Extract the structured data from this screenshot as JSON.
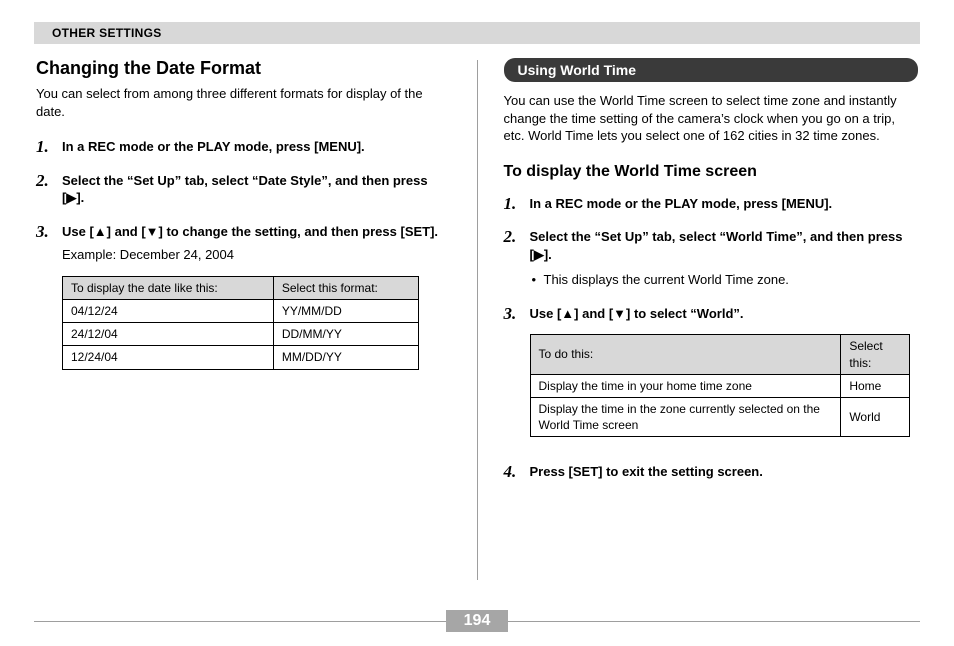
{
  "header": {
    "title": "OTHER SETTINGS"
  },
  "left": {
    "heading": "Changing the Date Format",
    "intro": "You can select from among three different formats for display of the date.",
    "steps": [
      {
        "text": "In a REC mode or the PLAY mode, press [MENU]."
      },
      {
        "text": "Select the “Set Up” tab, select “Date Style”, and then press [▶]."
      },
      {
        "text": "Use [▲] and [▼] to change the setting, and then press [SET].",
        "note": "Example: December 24, 2004"
      }
    ],
    "table": {
      "headers": [
        "To display the date like this:",
        "Select this format:"
      ],
      "rows": [
        [
          "04/12/24",
          "YY/MM/DD"
        ],
        [
          "24/12/04",
          "DD/MM/YY"
        ],
        [
          "12/24/04",
          "MM/DD/YY"
        ]
      ]
    }
  },
  "right": {
    "pill": "Using World Time",
    "intro": "You can use the World Time screen to select time zone and instantly change the time setting of the camera’s clock when you go on a trip, etc. World Time lets you select one of 162 cities in 32 time zones.",
    "subheading": "To display the World Time screen",
    "steps": [
      {
        "text": "In a REC mode or the PLAY mode, press [MENU]."
      },
      {
        "text": "Select the “Set Up” tab, select “World Time”, and then press [▶].",
        "bullet": "This displays the current World Time zone."
      },
      {
        "text": "Use [▲] and [▼] to select “World”."
      },
      {
        "text": "Press [SET] to exit the setting screen."
      }
    ],
    "table": {
      "headers": [
        "To do this:",
        "Select this:"
      ],
      "rows": [
        [
          "Display the time in your home time zone",
          "Home"
        ],
        [
          "Display the time in the zone currently selected on the World Time screen",
          "World"
        ]
      ]
    }
  },
  "page_number": "194"
}
